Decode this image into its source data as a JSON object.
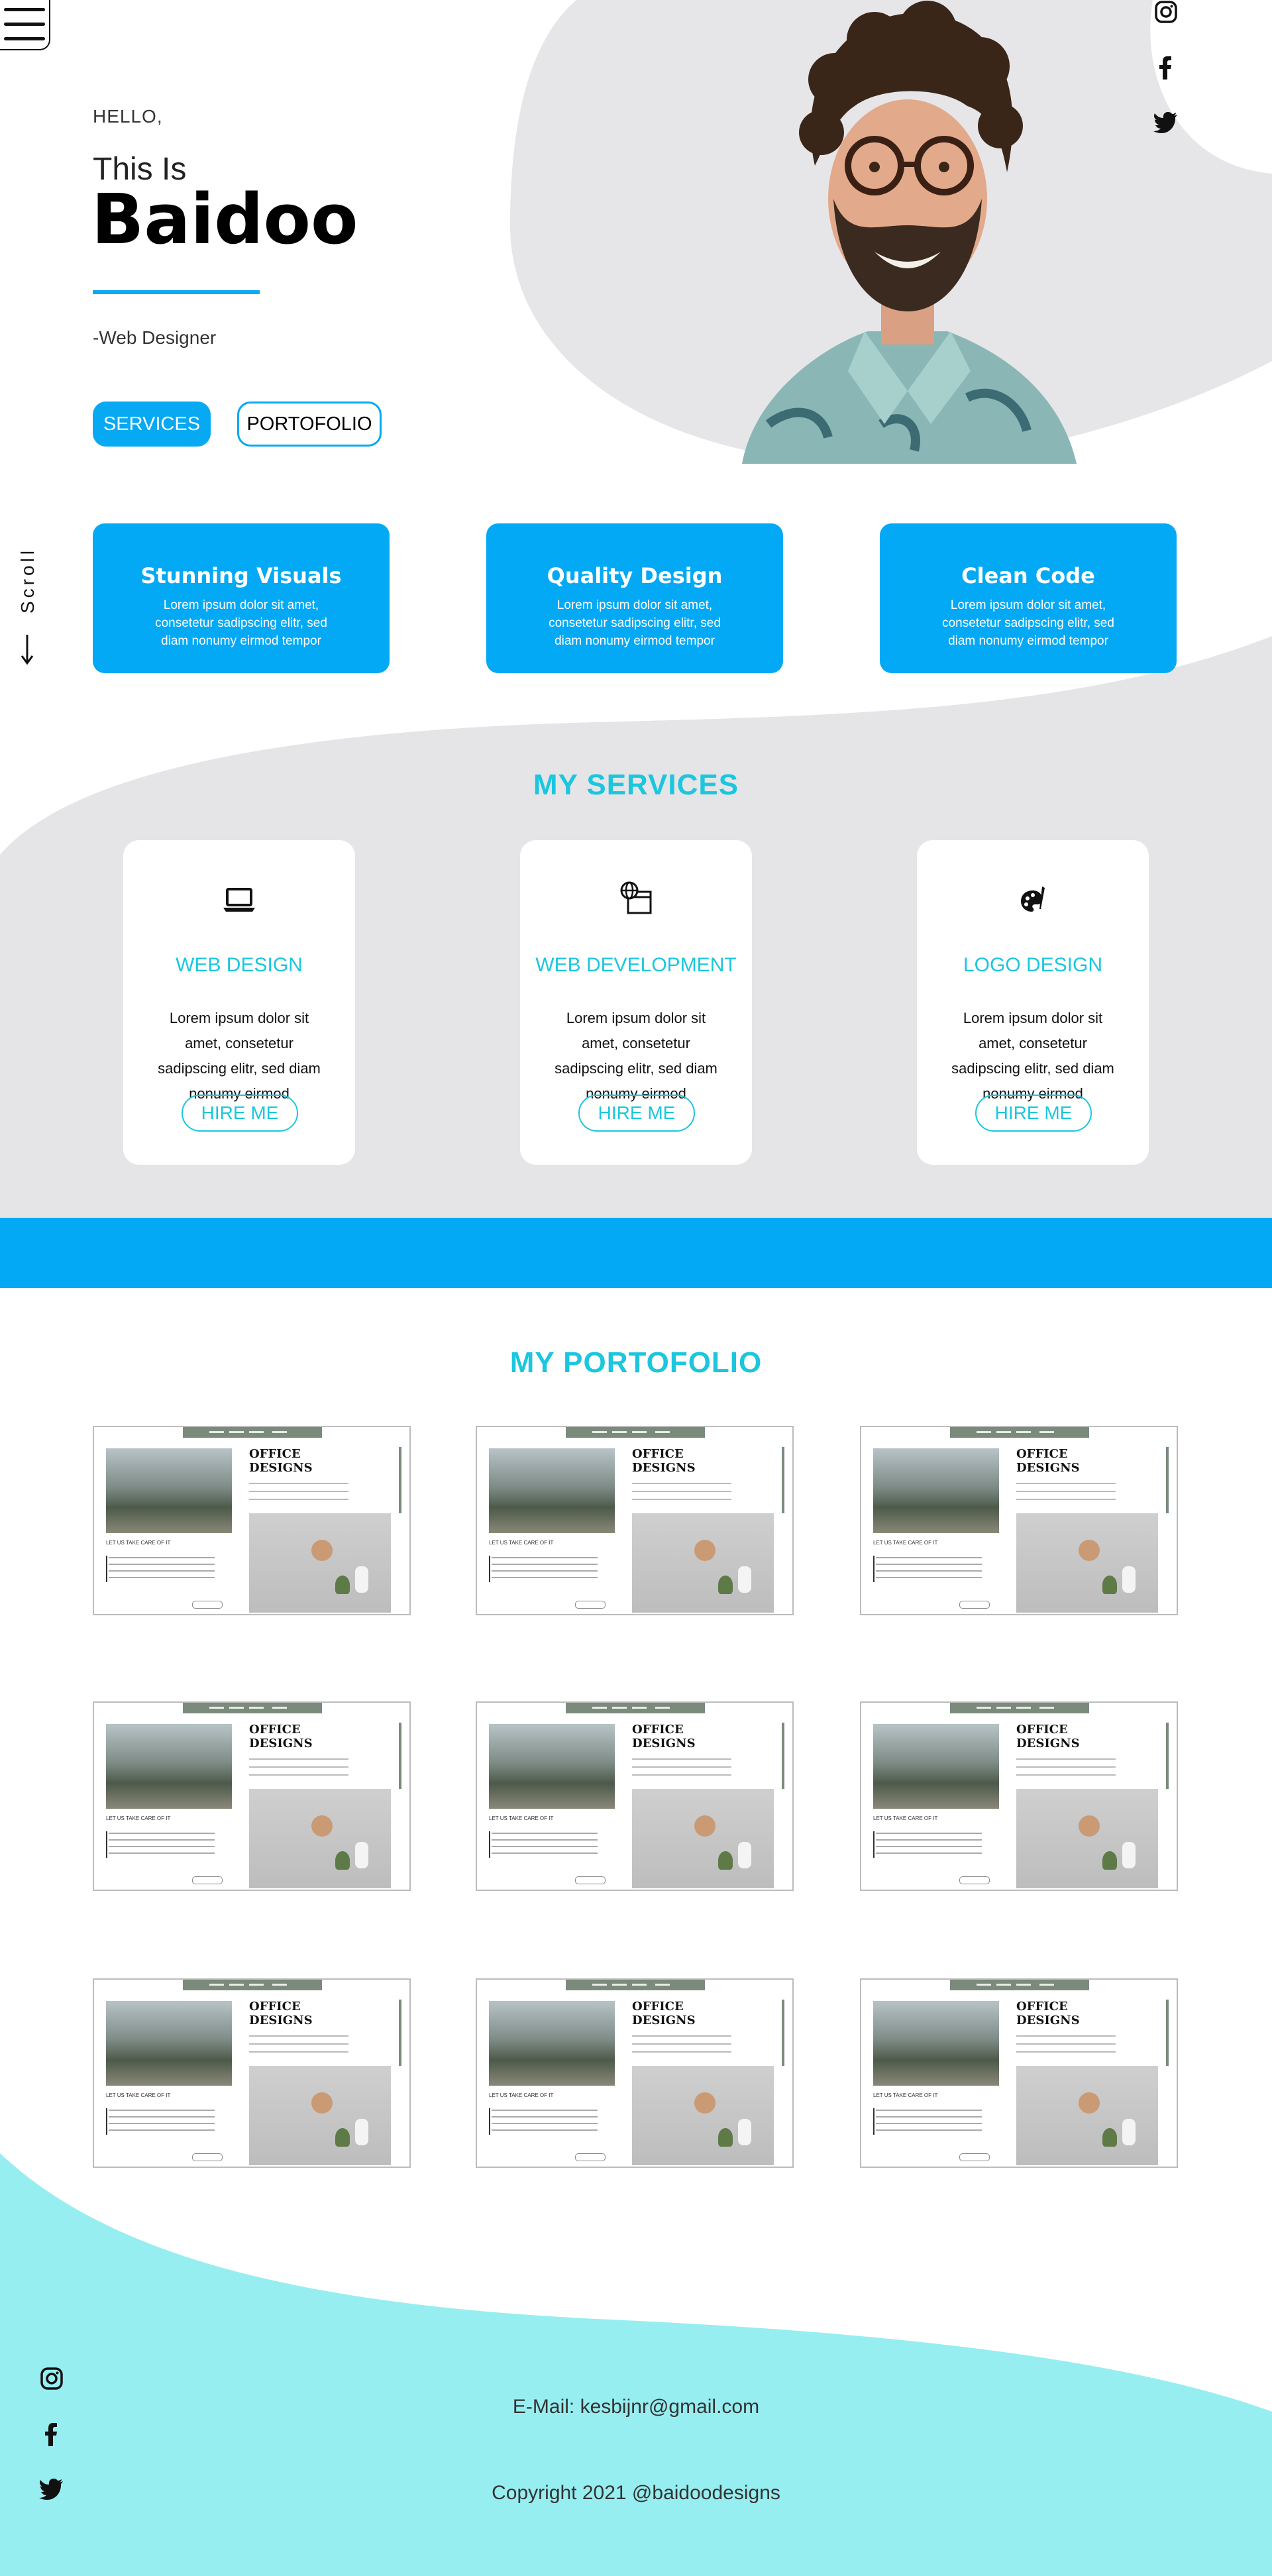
{
  "colors": {
    "accent": "#03a9f4",
    "teal": "#1bc6de",
    "footer": "#96eef0",
    "grey_band": "#e5e5e7"
  },
  "nav": {
    "menu_icon": "hamburger-icon"
  },
  "hero": {
    "greeting": "HELLO,",
    "intro": "This Is",
    "name": "Baidoo",
    "role": "-Web Designer",
    "services_button": "SERVICES",
    "portfolio_button": "PORTOFOLIO"
  },
  "social": [
    "instagram-icon",
    "facebook-icon",
    "twitter-icon"
  ],
  "features": [
    {
      "title": "Stunning Visuals",
      "text": "Lorem ipsum dolor sit amet, consetetur sadipscing elitr, sed diam nonumy eirmod tempor"
    },
    {
      "title": "Quality Design",
      "text": "Lorem ipsum dolor sit amet, consetetur sadipscing elitr, sed diam nonumy eirmod tempor"
    },
    {
      "title": "Clean Code",
      "text": "Lorem ipsum dolor sit amet, consetetur sadipscing elitr, sed diam nonumy eirmod tempor"
    }
  ],
  "scroll_label": "Scroll",
  "services": {
    "title": "MY SERVICES",
    "items": [
      {
        "icon": "laptop-icon",
        "title": "WEB DESIGN",
        "text": "Lorem ipsum dolor sit amet, consetetur sadipscing elitr, sed diam nonumy eirmod",
        "button": "HIRE ME"
      },
      {
        "icon": "web-globe-icon",
        "title": "WEB DEVELOPMENT",
        "text": "Lorem ipsum dolor sit amet, consetetur sadipscing elitr, sed diam nonumy eirmod",
        "button": "HIRE ME"
      },
      {
        "icon": "palette-brush-icon",
        "title": "LOGO DESIGN",
        "text": "Lorem ipsum dolor sit amet, consetetur sadipscing elitr, sed diam nonumy eirmod",
        "button": "HIRE ME"
      }
    ]
  },
  "portfolio": {
    "title": "MY PORTOFOLIO",
    "thumb_title_line1": "OFFICE",
    "thumb_title_line2": "DESIGNS",
    "thumb_caption": "LET US TAKE CARE OF IT",
    "count": 9
  },
  "footer": {
    "email": "E-Mail: kesbijnr@gmail.com",
    "copyright": "Copyright 2021 @baidoodesigns"
  }
}
